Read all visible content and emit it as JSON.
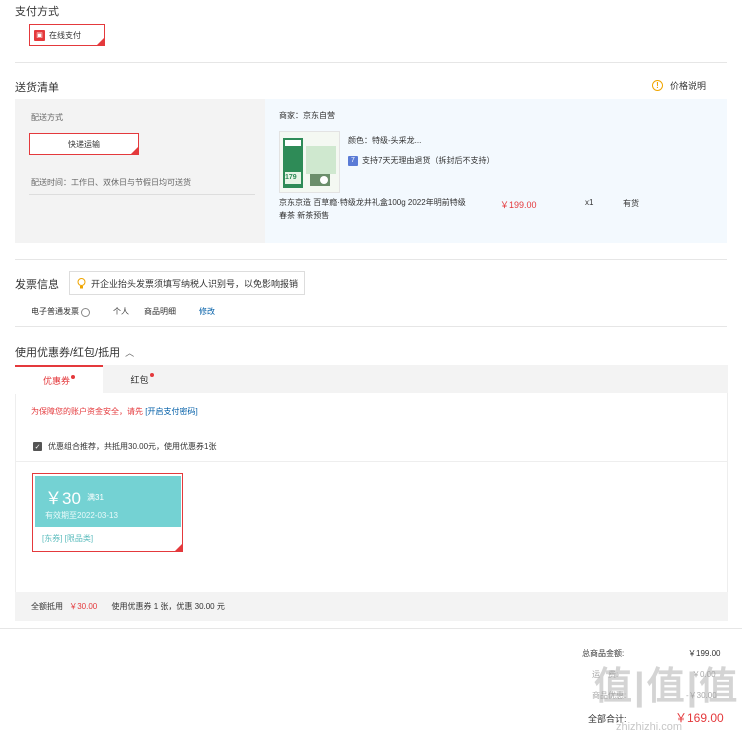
{
  "payment": {
    "title": "支付方式",
    "option_label": "在线支付",
    "option_icon": "card-icon"
  },
  "delivery": {
    "title": "送货清单",
    "price_help": "价格说明",
    "method_label": "配送方式",
    "method_button": "快递运输",
    "time_text": "配送时间：工作日、双休日与节假日均可送货",
    "merchant": "商家：京东自营",
    "color_text": "颜色：特级-头采龙...",
    "return_text": "支持7天无理由退货（拆封后不支持）",
    "product_name": "京东京造 百草瘾·特级龙井礼盒100g 2022年明前特级春茶 新茶预售",
    "price": "￥199.00",
    "quantity": "x1",
    "stock": "有货",
    "image_badge": "179"
  },
  "invoice": {
    "title": "发票信息",
    "tip": "开企业抬头发票须填写纳税人识别号，以免影响报销",
    "type": "电子普通发票",
    "person": "个人",
    "detail": "商品明细",
    "edit": "修改"
  },
  "coupons": {
    "title": "使用优惠券/红包/抵用",
    "tab_coupon": "优惠券",
    "tab_redpacket": "红包",
    "security_prefix": "为保障您的账户资金安全，请先",
    "security_link": "[开启支付密码]",
    "combo_text": "优惠组合推荐，共抵用30.00元，使用优惠券1张",
    "card": {
      "amount": "￥30",
      "condition": "满31",
      "expiry": "有效期至2022-03-13",
      "tags": "[东券] [限品类]"
    },
    "footer_label": "全额抵用",
    "footer_amount": "￥30.00",
    "footer_desc": "使用优惠券 1 张，优惠 30.00 元"
  },
  "summary": {
    "total_label": "总商品金额:",
    "total_value": "￥199.00",
    "row2_label": "运　费:",
    "row2_value": "￥0.00",
    "row3_label": "商品优惠:",
    "row3_value": "-￥30.00",
    "pay_label": "全部合计:",
    "pay_value": "￥169.00",
    "watermark": "值|值|值",
    "watermark_url": "zhizhizhi.com"
  },
  "colors": {
    "accent": "#e4393c",
    "coupon": "#74d2d3",
    "link": "#005ea7"
  }
}
